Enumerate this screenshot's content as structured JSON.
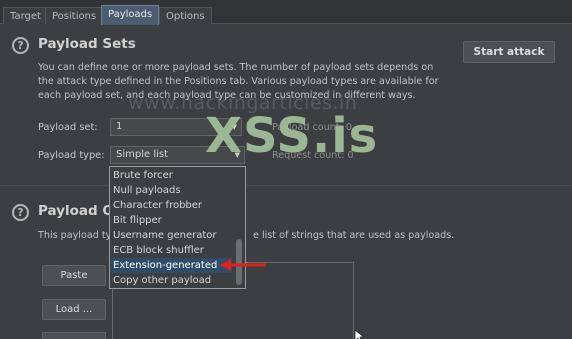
{
  "tabs": [
    {
      "label": "Target"
    },
    {
      "label": "Positions"
    },
    {
      "label": "Payloads"
    },
    {
      "label": "Options"
    }
  ],
  "payload_sets": {
    "title": "Payload Sets",
    "description_lines": [
      "You can define one or more payload sets. The number of payload sets depends on",
      "the attack type defined in the Positions tab. Various payload types are available for",
      "each payload set, and each payload type can be customized in different ways."
    ],
    "start_attack_label": "Start attack",
    "payload_set_label": "Payload set:",
    "payload_set_value": "1",
    "payload_type_label": "Payload type:",
    "payload_type_value": "Simple list",
    "payload_count_text": "Payload count: 0",
    "request_count_text": "Request count: 0"
  },
  "payload_options": {
    "title_visible": "Payload O",
    "description_left": "This payload ty",
    "description_right": "e list of strings that are used as payloads.",
    "paste_label": "Paste",
    "load_label": "Load ..."
  },
  "dropdown": {
    "items": [
      "Brute forcer",
      "Null payloads",
      "Character frobber",
      "Bit flipper",
      "Username generator",
      "ECB block shuffler",
      "Extension-generated",
      "Copy other payload"
    ],
    "selected_index": 6
  },
  "watermark": {
    "logo_text": "XSS.is",
    "url_text": "www.hackingarticles.in"
  },
  "colors": {
    "accent_arrow": "#e0201b",
    "selected_bg": "#2f4d6b"
  }
}
